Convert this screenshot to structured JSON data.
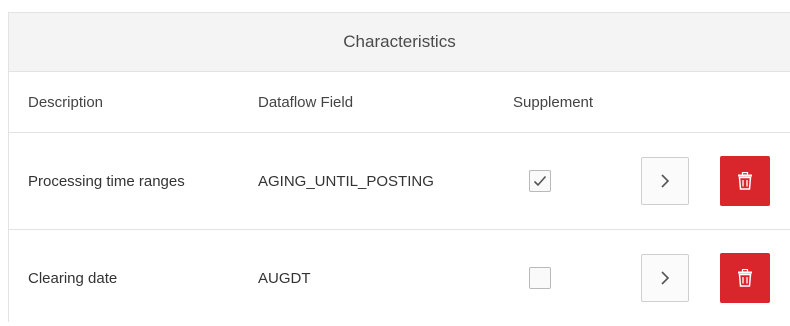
{
  "panel": {
    "title": "Characteristics"
  },
  "table": {
    "columns": [
      "Description",
      "Dataflow Field",
      "Supplement"
    ],
    "rows": [
      {
        "description": "Processing time ranges",
        "dataflow_field": "AGING_UNTIL_POSTING",
        "supplement": true
      },
      {
        "description": "Clearing date",
        "dataflow_field": "AUGDT",
        "supplement": false
      }
    ]
  },
  "icons": {
    "navigate": "chevron-right-icon",
    "delete": "trash-icon",
    "checked": "checkmark-icon"
  },
  "colors": {
    "delete_button": "#d9262c",
    "header_background": "#f4f4f4",
    "border": "#e3e3e3"
  }
}
